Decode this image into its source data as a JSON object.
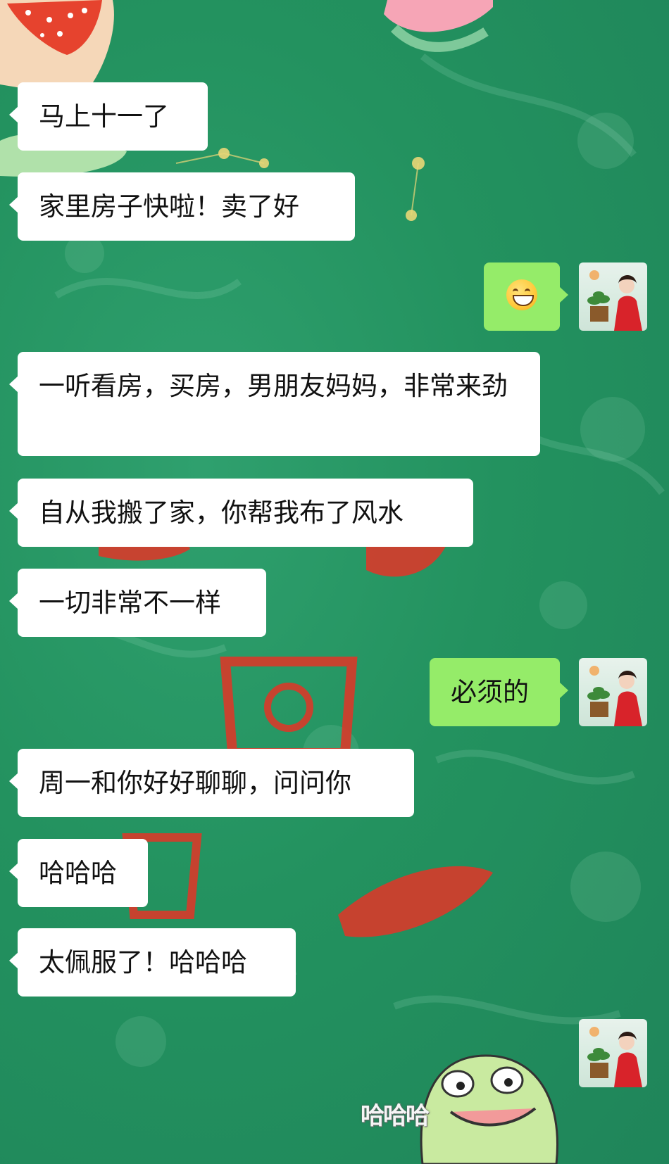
{
  "colors": {
    "background": "#23925f",
    "incoming_bubble": "#ffffff",
    "outgoing_bubble": "#95ec69",
    "text": "#111111"
  },
  "messages": [
    {
      "side": "in",
      "text": "马上十一了"
    },
    {
      "side": "in",
      "text": "家里房子快啦！卖了好"
    },
    {
      "side": "out",
      "type": "emoji",
      "icon": "grinning-face-emoji"
    },
    {
      "side": "in",
      "text": "一听看房，买房，男朋友妈妈，非常来劲"
    },
    {
      "side": "in",
      "text": "自从我搬了家，你帮我布了风水"
    },
    {
      "side": "in",
      "text": "一切非常不一样"
    },
    {
      "side": "out",
      "text": "必须的"
    },
    {
      "side": "in",
      "text": "周一和你好好聊聊，问问你"
    },
    {
      "side": "in",
      "text": "哈哈哈"
    },
    {
      "side": "in",
      "text": "太佩服了！哈哈哈"
    },
    {
      "side": "out",
      "type": "sticker",
      "icon": "green-frog-laughing-sticker",
      "text": "哈哈哈"
    }
  ]
}
